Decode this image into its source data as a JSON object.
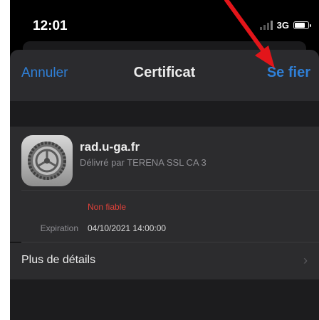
{
  "status_bar": {
    "time": "12:01",
    "network": "3G"
  },
  "nav": {
    "cancel_label": "Annuler",
    "title": "Certificat",
    "trust_label": "Se fier"
  },
  "certificate": {
    "name": "rad.u-ga.fr",
    "issuer": "Délivré par TERENA SSL CA 3",
    "status": "Non fiable",
    "expiration_label": "Expiration",
    "expiration_value": "04/10/2021 14:00:00"
  },
  "details": {
    "label": "Plus de détails"
  },
  "icons": {
    "cert": "gear-icon",
    "chevron": "chevron-right-icon",
    "annotation": "red-arrow-icon"
  },
  "colors": {
    "accent": "#2f7fd6",
    "danger": "#e0413a",
    "annotation": "#e3151a"
  }
}
